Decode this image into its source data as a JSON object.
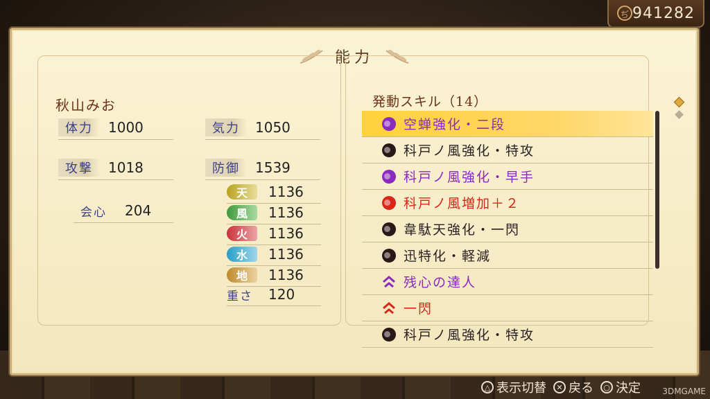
{
  "money": {
    "value": "941282"
  },
  "title": "能力",
  "character": {
    "name": "秋山みお"
  },
  "stats": {
    "hp": {
      "label": "体力",
      "value": "1000"
    },
    "ki": {
      "label": "気力",
      "value": "1050"
    },
    "attack": {
      "label": "攻撃",
      "value": "1018"
    },
    "defense": {
      "label": "防御",
      "value": "1539"
    },
    "crit": {
      "label": "会心",
      "value": "204"
    },
    "weight": {
      "label": "重さ",
      "value": "120"
    }
  },
  "elements": [
    {
      "label": "天",
      "value": "1136",
      "color": "#b7a21f"
    },
    {
      "label": "風",
      "value": "1136",
      "color": "#3f9a3c"
    },
    {
      "label": "火",
      "value": "1136",
      "color": "#c8323c"
    },
    {
      "label": "水",
      "value": "1136",
      "color": "#2a9ec6"
    },
    {
      "label": "地",
      "value": "1136",
      "color": "#c08a2e"
    }
  ],
  "skills": {
    "header": "発動スキル（14）",
    "items": [
      {
        "label": "空蝉強化・二段",
        "icon": "purple-orb-icon",
        "color": "purple",
        "selected": true
      },
      {
        "label": "科戸ノ風強化・特攻",
        "icon": "dark-orb-icon",
        "color": "dark"
      },
      {
        "label": "科戸ノ風強化・早手",
        "icon": "purple-orb-icon",
        "color": "purple"
      },
      {
        "label": "科戸ノ風増加＋２",
        "icon": "red-orb-icon",
        "color": "red"
      },
      {
        "label": "韋駄天強化・一閃",
        "icon": "dark-orb-icon",
        "color": "dark"
      },
      {
        "label": "迅特化・軽減",
        "icon": "dark-orb-icon",
        "color": "dark"
      },
      {
        "label": "残心の達人",
        "icon": "purple-chevron-icon",
        "color": "purple"
      },
      {
        "label": "一閃",
        "icon": "red-chevron-icon",
        "color": "red"
      },
      {
        "label": "科戸ノ風強化・特攻",
        "icon": "dark-orb-icon",
        "color": "dark"
      }
    ]
  },
  "controls": {
    "toggle_view": "表示切替",
    "back": "戻る",
    "confirm": "決定"
  },
  "watermark": "3DMGAME"
}
